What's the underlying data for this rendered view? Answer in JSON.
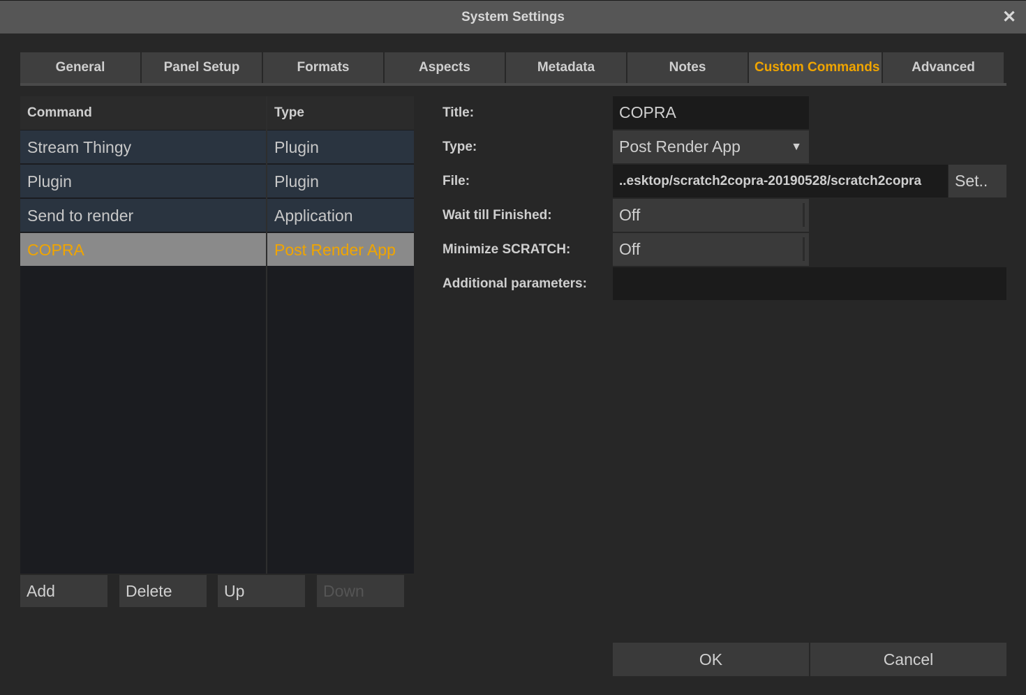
{
  "window": {
    "title": "System Settings"
  },
  "tabs": [
    {
      "label": "General"
    },
    {
      "label": "Panel Setup"
    },
    {
      "label": "Formats"
    },
    {
      "label": "Aspects"
    },
    {
      "label": "Metadata"
    },
    {
      "label": "Notes"
    },
    {
      "label": "Custom Commands"
    },
    {
      "label": "Advanced"
    }
  ],
  "active_tab": "Custom Commands",
  "list": {
    "headers": {
      "command": "Command",
      "type": "Type"
    },
    "rows": [
      {
        "command": "Stream Thingy",
        "type": "Plugin"
      },
      {
        "command": "Plugin",
        "type": "Plugin"
      },
      {
        "command": "Send to render",
        "type": "Application"
      },
      {
        "command": "COPRA",
        "type": "Post Render App",
        "selected": true
      }
    ]
  },
  "list_buttons": {
    "add": "Add",
    "delete": "Delete",
    "up": "Up",
    "down": "Down"
  },
  "form": {
    "title_label": "Title:",
    "title_value": "COPRA",
    "type_label": "Type:",
    "type_value": "Post Render App",
    "file_label": "File:",
    "file_value": "..esktop/scratch2copra-20190528/scratch2copra",
    "set_button": "Set..",
    "wait_label": "Wait till Finished:",
    "wait_value": "Off",
    "minimize_label": "Minimize SCRATCH:",
    "minimize_value": "Off",
    "params_label": "Additional parameters:",
    "params_value": ""
  },
  "dialog_buttons": {
    "ok": "OK",
    "cancel": "Cancel"
  },
  "colors": {
    "accent": "#f0a500",
    "selected_row": "#8a8a8a",
    "row_bg": "#2a3440"
  },
  "icons": {
    "close": "close-icon",
    "dropdown": "chevron-down-icon"
  }
}
